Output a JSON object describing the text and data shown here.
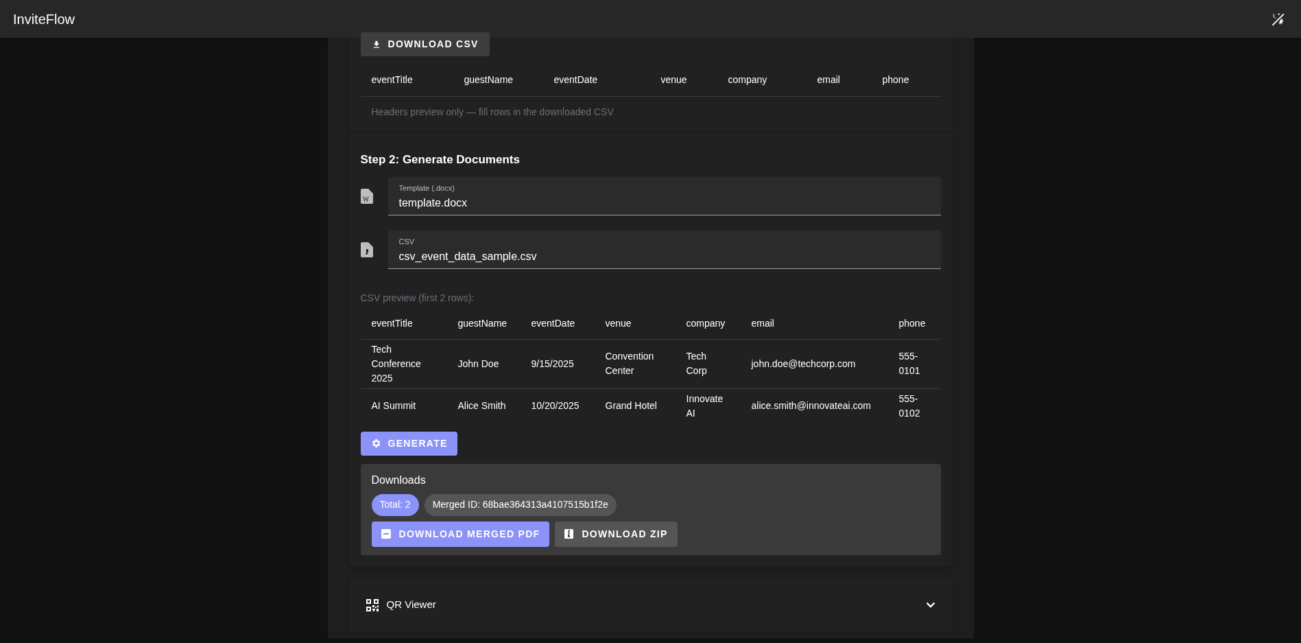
{
  "app_bar": {
    "title": "InviteFlow"
  },
  "template_section": {
    "download_button": "DOWNLOAD CSV",
    "columns": [
      "eventTitle",
      "guestName",
      "eventDate",
      "venue",
      "company",
      "email",
      "phone"
    ],
    "note": "Headers preview only — fill rows in the downloaded CSV"
  },
  "generate_section": {
    "title": "Step 2: Generate Documents",
    "fields": [
      {
        "kind": "word",
        "label": "Template (.docx)",
        "value": "template.docx"
      },
      {
        "kind": "csv",
        "label": "CSV",
        "value": "csv_event_data_sample.csv"
      }
    ],
    "preview_label": "CSV preview (first 2 rows):",
    "preview_table": {
      "columns": [
        "eventTitle",
        "guestName",
        "eventDate",
        "venue",
        "company",
        "email",
        "phone"
      ],
      "rows": [
        [
          "Tech Conference 2025",
          "John Doe",
          "9/15/2025",
          "Convention Center",
          "Tech Corp",
          "john.doe@techcorp.com",
          "555-0101"
        ],
        [
          "AI Summit",
          "Alice Smith",
          "10/20/2025",
          "Grand Hotel",
          "Innovate AI",
          "alice.smith@innovateai.com",
          "555-0102"
        ]
      ]
    },
    "generate_button": "GENERATE",
    "downloads": {
      "title": "Downloads",
      "chips": [
        {
          "kind": "primary",
          "label": "Total: 2"
        },
        {
          "kind": "neutral",
          "label": "Merged ID: 68bae364313a4107515b1f2e"
        }
      ],
      "buttons": [
        {
          "kind": "primary",
          "label": "DOWNLOAD MERGED PDF"
        },
        {
          "kind": "neutral",
          "label": "DOWNLOAD ZIP"
        }
      ]
    }
  },
  "qr_viewer": {
    "title": "QR Viewer",
    "expanded": false
  }
}
